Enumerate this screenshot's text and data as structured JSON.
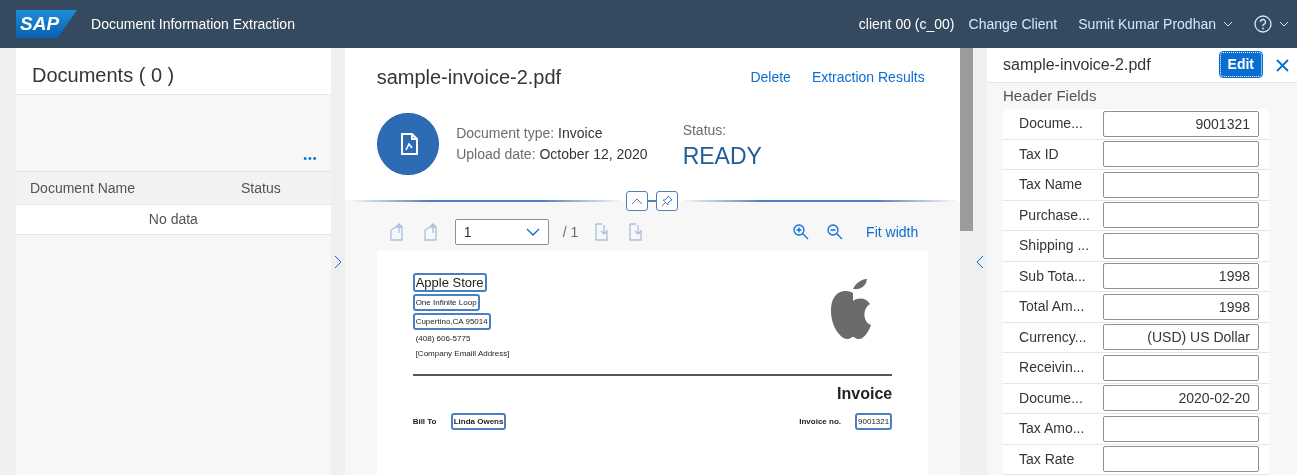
{
  "shell": {
    "logo": "SAP",
    "title": "Document Information Extraction",
    "client": "client 00 (c_00)",
    "change_client": "Change Client",
    "user": "Sumit Kumar Prodhan"
  },
  "documents": {
    "title": "Documents ( 0 )",
    "more": "•••",
    "columns": [
      "Document Name",
      "Status"
    ],
    "empty": "No data"
  },
  "detail": {
    "title": "sample-invoice-2.pdf",
    "actions": [
      "Delete",
      "Extraction Results"
    ],
    "type_label": "Document type:",
    "type_value": "Invoice",
    "date_label": "Upload date:",
    "date_value": "October 12, 2020",
    "status_label": "Status:",
    "status_value": "READY",
    "toolbar": {
      "page": "1",
      "page_count": "/ 1",
      "fit": "Fit width"
    },
    "invoice": {
      "lines": [
        {
          "text": "Apple Store",
          "kind": "name",
          "highlighted": true
        },
        {
          "text": "One Infinite Loop",
          "kind": "line",
          "highlighted": true
        },
        {
          "text": "Cupertino,CA 95014",
          "kind": "line",
          "highlighted": true
        },
        {
          "text": "(408) 606-5775",
          "kind": "line",
          "highlighted": false
        },
        {
          "text": "[Company Emaill Address]",
          "kind": "line",
          "highlighted": false
        }
      ],
      "heading": "Invoice",
      "bill_to_label": "Bill To",
      "bill_to": "Linda Owens",
      "invoice_no_label": "Invoice no.",
      "invoice_no": "9001321"
    }
  },
  "extraction": {
    "title": "sample-invoice-2.pdf",
    "edit": "Edit",
    "section": "Header Fields",
    "fields": [
      {
        "label": "Docume...",
        "value": "9001321"
      },
      {
        "label": "Tax ID"
      },
      {
        "label": "Tax Name"
      },
      {
        "label": "Purchase..."
      },
      {
        "label": "Shipping ..."
      },
      {
        "label": "Sub Tota...",
        "value": "1998"
      },
      {
        "label": "Total Am...",
        "value": "1998"
      },
      {
        "label": "Currency...",
        "value": "(USD) US Dollar"
      },
      {
        "label": "Receivin..."
      },
      {
        "label": "Docume...",
        "value": "2020-02-20"
      },
      {
        "label": "Tax Amo..."
      },
      {
        "label": "Tax Rate"
      }
    ]
  }
}
